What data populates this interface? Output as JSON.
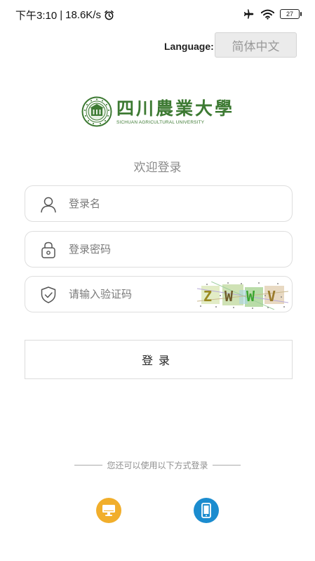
{
  "status_bar": {
    "time": "下午3:10",
    "separator": "|",
    "network_speed": "18.6K/s",
    "battery_level": "27"
  },
  "language": {
    "label": "Language:",
    "selected": "简体中文"
  },
  "logo": {
    "chinese_name": "四川農業大學",
    "english_name": "SICHUAN AGRICULTURAL UNIVERSITY",
    "color": "#3d7a33"
  },
  "form": {
    "welcome": "欢迎登录",
    "username": {
      "placeholder": "登录名",
      "value": ""
    },
    "password": {
      "placeholder": "登录密码",
      "value": ""
    },
    "captcha": {
      "placeholder": "请输入验证码",
      "value": "",
      "image_text": [
        "Z",
        "W",
        "W",
        "V"
      ]
    },
    "submit_label": "登录"
  },
  "alternative_login": {
    "divider_text": "您还可以使用以下方式登录",
    "options": [
      {
        "icon": "computer-icon",
        "color": "#f1ae2b"
      },
      {
        "icon": "mobile-phone-icon",
        "color": "#1b8ccf"
      }
    ]
  }
}
